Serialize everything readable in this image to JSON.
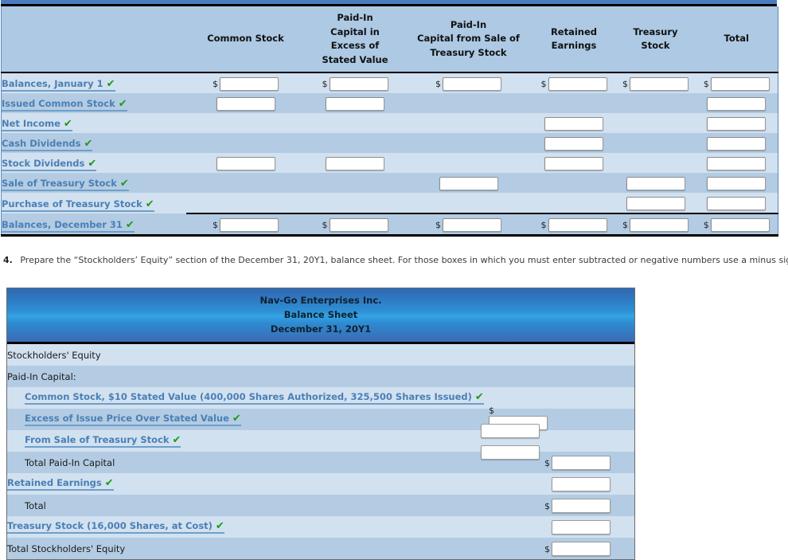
{
  "colors": {
    "link": "#4a7fb5",
    "check": "#1a9a1a",
    "row_light": "#d2e1f0",
    "row_dark": "#b3cce3",
    "header_blue": "#adc9e4",
    "top_bar": "#4a7cbf",
    "bs_header_gradient_top": "#2f6cb5",
    "bs_header_gradient_mid": "#34a3e4"
  },
  "icons": {
    "check": "✔",
    "dollar": "$"
  },
  "statement_of_stockholders_equity": {
    "columns": [
      {
        "name": "row-label",
        "label": ""
      },
      {
        "name": "common-stock",
        "label": "Common Stock"
      },
      {
        "name": "paid-in-capital-excess-stated-value",
        "label": "Paid-In\nCapital in\nExcess of\nStated Value"
      },
      {
        "name": "paid-in-capital-sale-treasury-stock",
        "label": "Paid-In\nCapital from Sale of\nTreasury Stock"
      },
      {
        "name": "retained-earnings",
        "label": "Retained\nEarnings"
      },
      {
        "name": "treasury-stock",
        "label": "Treasury\nStock"
      },
      {
        "name": "total",
        "label": "Total"
      }
    ],
    "column_labels": {
      "common_stock": "Common Stock",
      "paid_in_excess_l1": "Paid-In",
      "paid_in_excess_l2": "Capital in",
      "paid_in_excess_l3": "Excess of",
      "paid_in_excess_l4": "Stated Value",
      "paid_in_sale_l1": "Paid-In",
      "paid_in_sale_l2": "Capital from Sale of",
      "paid_in_sale_l3": "Treasury Stock",
      "retained_l1": "Retained",
      "retained_l2": "Earnings",
      "treasury_l1": "Treasury",
      "treasury_l2": "Stock",
      "total": "Total"
    },
    "rows": [
      {
        "label": "Balances, January 1",
        "checked": true,
        "shade": "light",
        "is_total": false,
        "cells": [
          {
            "input": true,
            "dollar": true,
            "value": ""
          },
          {
            "input": true,
            "dollar": true,
            "value": ""
          },
          {
            "input": true,
            "dollar": true,
            "value": ""
          },
          {
            "input": true,
            "dollar": true,
            "value": ""
          },
          {
            "input": true,
            "dollar": true,
            "value": ""
          },
          {
            "input": true,
            "dollar": true,
            "value": ""
          }
        ]
      },
      {
        "label": "Issued Common Stock",
        "checked": true,
        "shade": "dark",
        "is_total": false,
        "cells": [
          {
            "input": true,
            "dollar": false,
            "value": ""
          },
          {
            "input": true,
            "dollar": false,
            "value": ""
          },
          {
            "input": false
          },
          {
            "input": false
          },
          {
            "input": false
          },
          {
            "input": true,
            "dollar": false,
            "value": ""
          }
        ]
      },
      {
        "label": "Net Income",
        "checked": true,
        "shade": "light",
        "is_total": false,
        "cells": [
          {
            "input": false
          },
          {
            "input": false
          },
          {
            "input": false
          },
          {
            "input": true,
            "dollar": false,
            "value": ""
          },
          {
            "input": false
          },
          {
            "input": true,
            "dollar": false,
            "value": ""
          }
        ]
      },
      {
        "label": "Cash Dividends",
        "checked": true,
        "shade": "dark",
        "is_total": false,
        "cells": [
          {
            "input": false
          },
          {
            "input": false
          },
          {
            "input": false
          },
          {
            "input": true,
            "dollar": false,
            "value": ""
          },
          {
            "input": false
          },
          {
            "input": true,
            "dollar": false,
            "value": ""
          }
        ]
      },
      {
        "label": "Stock Dividends",
        "checked": true,
        "shade": "light",
        "is_total": false,
        "cells": [
          {
            "input": true,
            "dollar": false,
            "value": ""
          },
          {
            "input": true,
            "dollar": false,
            "value": ""
          },
          {
            "input": false
          },
          {
            "input": true,
            "dollar": false,
            "value": ""
          },
          {
            "input": false
          },
          {
            "input": true,
            "dollar": false,
            "value": ""
          }
        ]
      },
      {
        "label": "Sale of Treasury Stock",
        "checked": true,
        "shade": "dark",
        "is_total": false,
        "cells": [
          {
            "input": false
          },
          {
            "input": false
          },
          {
            "input": true,
            "dollar": false,
            "value": ""
          },
          {
            "input": false
          },
          {
            "input": true,
            "dollar": false,
            "value": ""
          },
          {
            "input": true,
            "dollar": false,
            "value": ""
          }
        ]
      },
      {
        "label": "Purchase of Treasury Stock",
        "checked": true,
        "shade": "light",
        "is_total": false,
        "cells": [
          {
            "input": false
          },
          {
            "input": false
          },
          {
            "input": false
          },
          {
            "input": false
          },
          {
            "input": true,
            "dollar": false,
            "value": ""
          },
          {
            "input": true,
            "dollar": false,
            "value": ""
          }
        ]
      },
      {
        "label": "Balances, December 31",
        "checked": true,
        "shade": "dark",
        "is_total": true,
        "cells": [
          {
            "input": true,
            "dollar": true,
            "value": ""
          },
          {
            "input": true,
            "dollar": true,
            "value": ""
          },
          {
            "input": true,
            "dollar": true,
            "value": ""
          },
          {
            "input": true,
            "dollar": true,
            "value": ""
          },
          {
            "input": true,
            "dollar": true,
            "value": ""
          },
          {
            "input": true,
            "dollar": true,
            "value": ""
          }
        ]
      }
    ]
  },
  "instruction": {
    "number": "4.",
    "text": "Prepare the “Stockholders’ Equity” section of the December 31, 20Y1, balance sheet. For those boxes in which you must enter subtracted or negative numbers use a minus sign."
  },
  "balance_sheet": {
    "header": {
      "company": "Nav-Go Enterprises Inc.",
      "statement": "Balance Sheet",
      "date": "December 31, 20Y1"
    },
    "rows": [
      {
        "label": "Stockholders' Equity",
        "link": false,
        "checked": false,
        "indent": 0,
        "shade": "light",
        "input": false,
        "dollar": false,
        "col": 0
      },
      {
        "label": "Paid-In Capital:",
        "link": false,
        "checked": false,
        "indent": 0,
        "shade": "dark",
        "input": false,
        "dollar": false,
        "col": 0
      },
      {
        "label": "Common Stock, $10 Stated Value (400,000 Shares Authorized, 325,500 Shares Issued)",
        "link": true,
        "checked": true,
        "indent": 1,
        "shade": "light",
        "input": true,
        "dollar": true,
        "col": 1,
        "value": ""
      },
      {
        "label": "Excess of Issue Price Over Stated Value",
        "link": true,
        "checked": true,
        "indent": 1,
        "shade": "dark",
        "input": true,
        "dollar": false,
        "col": 1,
        "value": ""
      },
      {
        "label": "From Sale of Treasury Stock",
        "link": true,
        "checked": true,
        "indent": 1,
        "shade": "light",
        "input": true,
        "dollar": false,
        "col": 1,
        "value": ""
      },
      {
        "label": "Total Paid-In Capital",
        "link": false,
        "checked": false,
        "indent": 1,
        "shade": "dark",
        "input": true,
        "dollar": true,
        "col": 2,
        "value": ""
      },
      {
        "label": "Retained Earnings",
        "link": true,
        "checked": true,
        "indent": 0,
        "shade": "light",
        "input": true,
        "dollar": false,
        "col": 2,
        "value": ""
      },
      {
        "label": "Total",
        "link": false,
        "checked": false,
        "indent": 1,
        "shade": "dark",
        "input": true,
        "dollar": true,
        "col": 2,
        "value": ""
      },
      {
        "label": "Treasury Stock (16,000 Shares, at Cost)",
        "link": true,
        "checked": true,
        "indent": 0,
        "shade": "light",
        "input": true,
        "dollar": false,
        "col": 2,
        "value": ""
      },
      {
        "label": "Total Stockholders' Equity",
        "link": false,
        "checked": false,
        "indent": 0,
        "shade": "dark",
        "input": true,
        "dollar": true,
        "col": 2,
        "value": ""
      }
    ]
  }
}
